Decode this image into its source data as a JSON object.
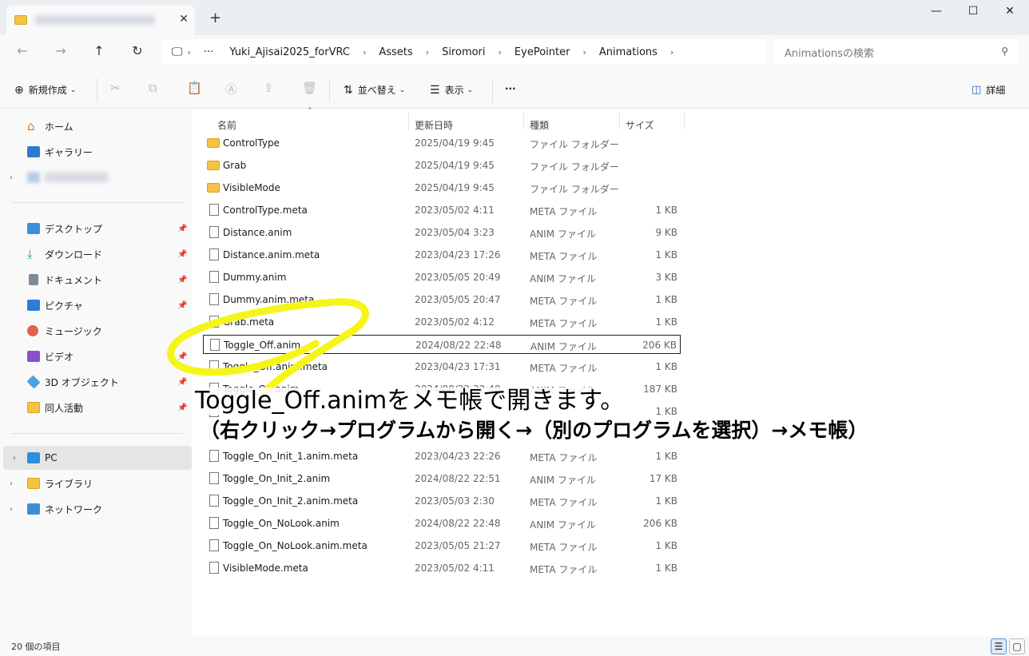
{
  "window": {
    "tab_close": "✕",
    "new_tab": "+",
    "minimize": "—",
    "maximize": "☐",
    "close": "✕"
  },
  "nav": {
    "breadcrumb": [
      "Yuki_Ajisai2025_forVRC",
      "Assets",
      "Siromori",
      "EyePointer",
      "Animations"
    ],
    "ellipsis": "···",
    "search_placeholder": "Animationsの検索"
  },
  "toolbar": {
    "new_label": "新規作成",
    "sort_label": "並べ替え",
    "view_label": "表示",
    "more_label": "···",
    "details_label": "詳細"
  },
  "sidebar": {
    "home": "ホーム",
    "gallery": "ギャラリー",
    "desktop": "デスクトップ",
    "downloads": "ダウンロード",
    "documents": "ドキュメント",
    "pictures": "ピクチャ",
    "music": "ミュージック",
    "videos": "ビデオ",
    "objects3d": "3D オブジェクト",
    "doujin": "同人活動",
    "pc": "PC",
    "libraries": "ライブラリ",
    "network": "ネットワーク"
  },
  "columns": {
    "name": "名前",
    "date": "更新日時",
    "type": "種類",
    "size": "サイズ"
  },
  "files": [
    {
      "name": "ControlType",
      "date": "2025/04/19 9:45",
      "type": "ファイル フォルダー",
      "size": "",
      "folder": true
    },
    {
      "name": "Grab",
      "date": "2025/04/19 9:45",
      "type": "ファイル フォルダー",
      "size": "",
      "folder": true
    },
    {
      "name": "VisibleMode",
      "date": "2025/04/19 9:45",
      "type": "ファイル フォルダー",
      "size": "",
      "folder": true
    },
    {
      "name": "ControlType.meta",
      "date": "2023/05/02 4:11",
      "type": "META ファイル",
      "size": "1 KB"
    },
    {
      "name": "Distance.anim",
      "date": "2023/05/04 3:23",
      "type": "ANIM ファイル",
      "size": "9 KB"
    },
    {
      "name": "Distance.anim.meta",
      "date": "2023/04/23 17:26",
      "type": "META ファイル",
      "size": "1 KB"
    },
    {
      "name": "Dummy.anim",
      "date": "2023/05/05 20:49",
      "type": "ANIM ファイル",
      "size": "3 KB"
    },
    {
      "name": "Dummy.anim.meta",
      "date": "2023/05/05 20:47",
      "type": "META ファイル",
      "size": "1 KB"
    },
    {
      "name": "Grab.meta",
      "date": "2023/05/02 4:12",
      "type": "META ファイル",
      "size": "1 KB"
    },
    {
      "name": "Toggle_Off.anim",
      "date": "2024/08/22 22:48",
      "type": "ANIM ファイル",
      "size": "206 KB",
      "selected": true
    },
    {
      "name": "Toggle_Off.anim.meta",
      "date": "2023/04/23 17:31",
      "type": "META ファイル",
      "size": "1 KB"
    },
    {
      "name": "Toggle_On.anim",
      "date": "2024/08/22 22:48",
      "type": "ANIM ファイル",
      "size": "187 KB"
    },
    {
      "name": "",
      "date": "",
      "type": "",
      "size": "1 KB"
    },
    {
      "name": "",
      "date": "",
      "type": "",
      "size": ""
    },
    {
      "name": "Toggle_On_Init_1.anim.meta",
      "date": "2023/04/23 22:26",
      "type": "META ファイル",
      "size": "1 KB"
    },
    {
      "name": "Toggle_On_Init_2.anim",
      "date": "2024/08/22 22:51",
      "type": "ANIM ファイル",
      "size": "17 KB"
    },
    {
      "name": "Toggle_On_Init_2.anim.meta",
      "date": "2023/05/03 2:30",
      "type": "META ファイル",
      "size": "1 KB"
    },
    {
      "name": "Toggle_On_NoLook.anim",
      "date": "2024/08/22 22:48",
      "type": "ANIM ファイル",
      "size": "206 KB"
    },
    {
      "name": "Toggle_On_NoLook.anim.meta",
      "date": "2023/05/05 21:27",
      "type": "META ファイル",
      "size": "1 KB"
    },
    {
      "name": "VisibleMode.meta",
      "date": "2023/05/02 4:11",
      "type": "META ファイル",
      "size": "1 KB"
    }
  ],
  "status": {
    "count": "20 個の項目"
  },
  "annotation": {
    "line1": "Toggle_Off.animをメモ帳で開きます。",
    "line2": "（右クリック→プログラムから開く→（別のプログラムを選択）→メモ帳）",
    "highlight_color": "#f5f51a"
  }
}
